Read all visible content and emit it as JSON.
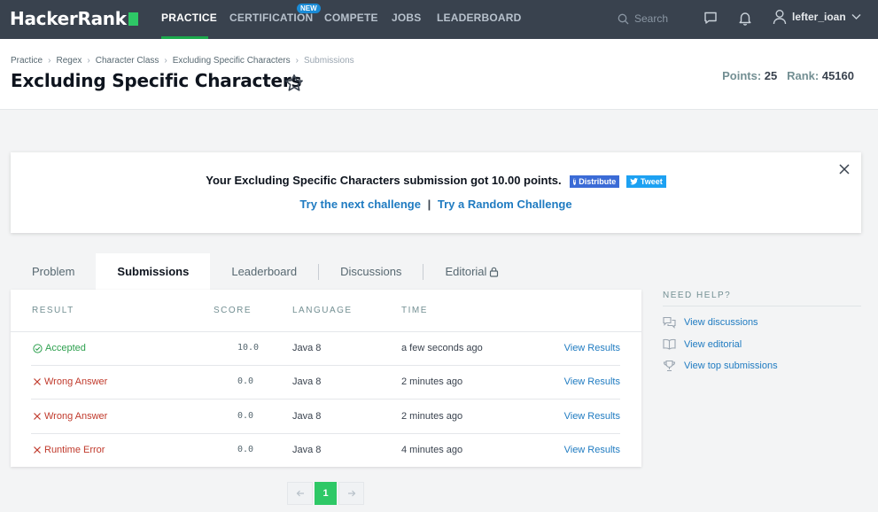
{
  "nav": {
    "logo": "HackerRank",
    "links": [
      "PRACTICE",
      "CERTIFICATION",
      "COMPETE",
      "JOBS",
      "LEADERBOARD"
    ],
    "new_badge": "NEW",
    "search_placeholder": "Search",
    "username": "lefter_ioan"
  },
  "breadcrumb": [
    "Practice",
    "Regex",
    "Character Class",
    "Excluding Specific Characters",
    "Submissions"
  ],
  "page_title": "Excluding Specific Characters",
  "stats": {
    "points_label": "Points:",
    "points": "25",
    "rank_label": "Rank:",
    "rank": "45160"
  },
  "banner": {
    "message": "Your Excluding Specific Characters submission got 10.00 points.",
    "fb_label": "Distribute",
    "tweet_label": "Tweet",
    "next_challenge": "Try the next challenge",
    "separator": "|",
    "random_challenge": "Try a Random Challenge"
  },
  "tabs": [
    "Problem",
    "Submissions",
    "Leaderboard",
    "Discussions",
    "Editorial"
  ],
  "table": {
    "headers": [
      "RESULT",
      "SCORE",
      "LANGUAGE",
      "TIME"
    ],
    "rows": [
      {
        "result": "Accepted",
        "score": "10.0",
        "language": "Java 8",
        "time": "a few seconds ago",
        "action": "View Results"
      },
      {
        "result": "Wrong Answer",
        "score": "0.0",
        "language": "Java 8",
        "time": "2 minutes ago",
        "action": "View Results"
      },
      {
        "result": "Wrong Answer",
        "score": "0.0",
        "language": "Java 8",
        "time": "2 minutes ago",
        "action": "View Results"
      },
      {
        "result": "Runtime Error",
        "score": "0.0",
        "language": "Java 8",
        "time": "4 minutes ago",
        "action": "View Results"
      }
    ]
  },
  "help": {
    "title": "NEED HELP?",
    "items": [
      "View discussions",
      "View editorial",
      "View top submissions"
    ]
  },
  "pagination": {
    "current": "1"
  },
  "colors": {
    "nav_bg": "#39424e",
    "accent_green": "#2ec866",
    "link_blue": "#1f7bc1",
    "error_red": "#c0392b"
  }
}
